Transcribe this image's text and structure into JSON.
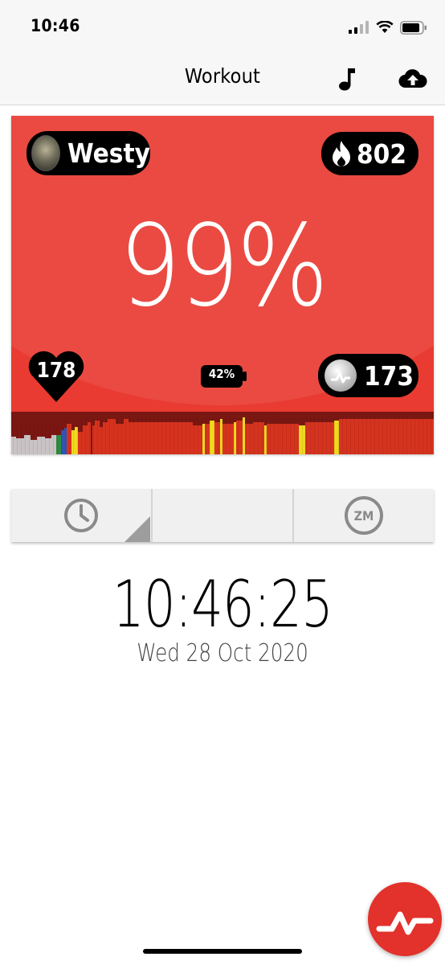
{
  "status_bar": {
    "time": "10:46"
  },
  "nav": {
    "title": "Workout",
    "icons": [
      "music-note-icon",
      "cloud-upload-icon"
    ]
  },
  "tile": {
    "background_color": "#e93b32",
    "user_name": "Westy",
    "calories": "802",
    "effort_percent": "99%",
    "heart_rate": "178",
    "battery": "42%",
    "points": "173",
    "zone_colors": [
      "#c9c3c6",
      "#2f55b4",
      "#2e8b3f",
      "#f0d81f",
      "#d6331f"
    ]
  },
  "tabs": [
    {
      "icon": "clock-icon"
    },
    {
      "icon": ""
    },
    {
      "icon": "zm-icon",
      "label": "ZM"
    }
  ],
  "clock": {
    "time": "10:46:25",
    "date": "Wed 28 Oct 2020"
  },
  "fab": {
    "icon": "myzone-pulse-icon"
  }
}
